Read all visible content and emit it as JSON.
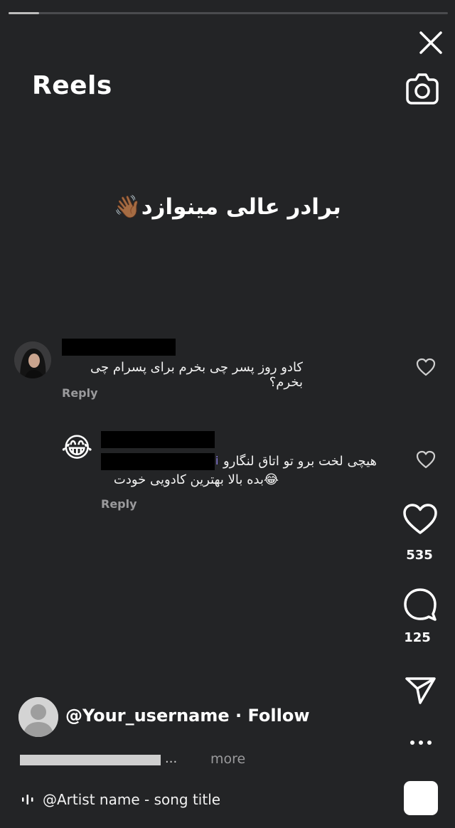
{
  "header": {
    "title": "Reels",
    "progress_fraction": 0.07
  },
  "caption": "برادر عالی مینوازد👋🏾",
  "comments": [
    {
      "text": "کادو روز پسر چی بخرم برای پسرام چی بخرم؟",
      "reply_label": "Reply"
    },
    {
      "avatar_emoji": "😂",
      "line1": "هیچی لخت برو تو اتاق لنگارو",
      "line2": "😂بده بالا بهترین کادویی خودت",
      "reply_label": "Reply"
    }
  ],
  "actions": {
    "likes": "535",
    "comments": "125"
  },
  "footer": {
    "username": "@Your_username",
    "separator": " · ",
    "follow_label": "Follow",
    "ellipsis": "...",
    "more_label": "more",
    "audio": "@Artist name - song title"
  },
  "icons": [
    "close-icon",
    "camera-icon",
    "heart-icon",
    "comment-icon",
    "send-icon",
    "more-icon",
    "music-icon"
  ],
  "colors": {
    "background": "#232426",
    "text": "#ffffff",
    "muted": "#9a9a9c"
  }
}
